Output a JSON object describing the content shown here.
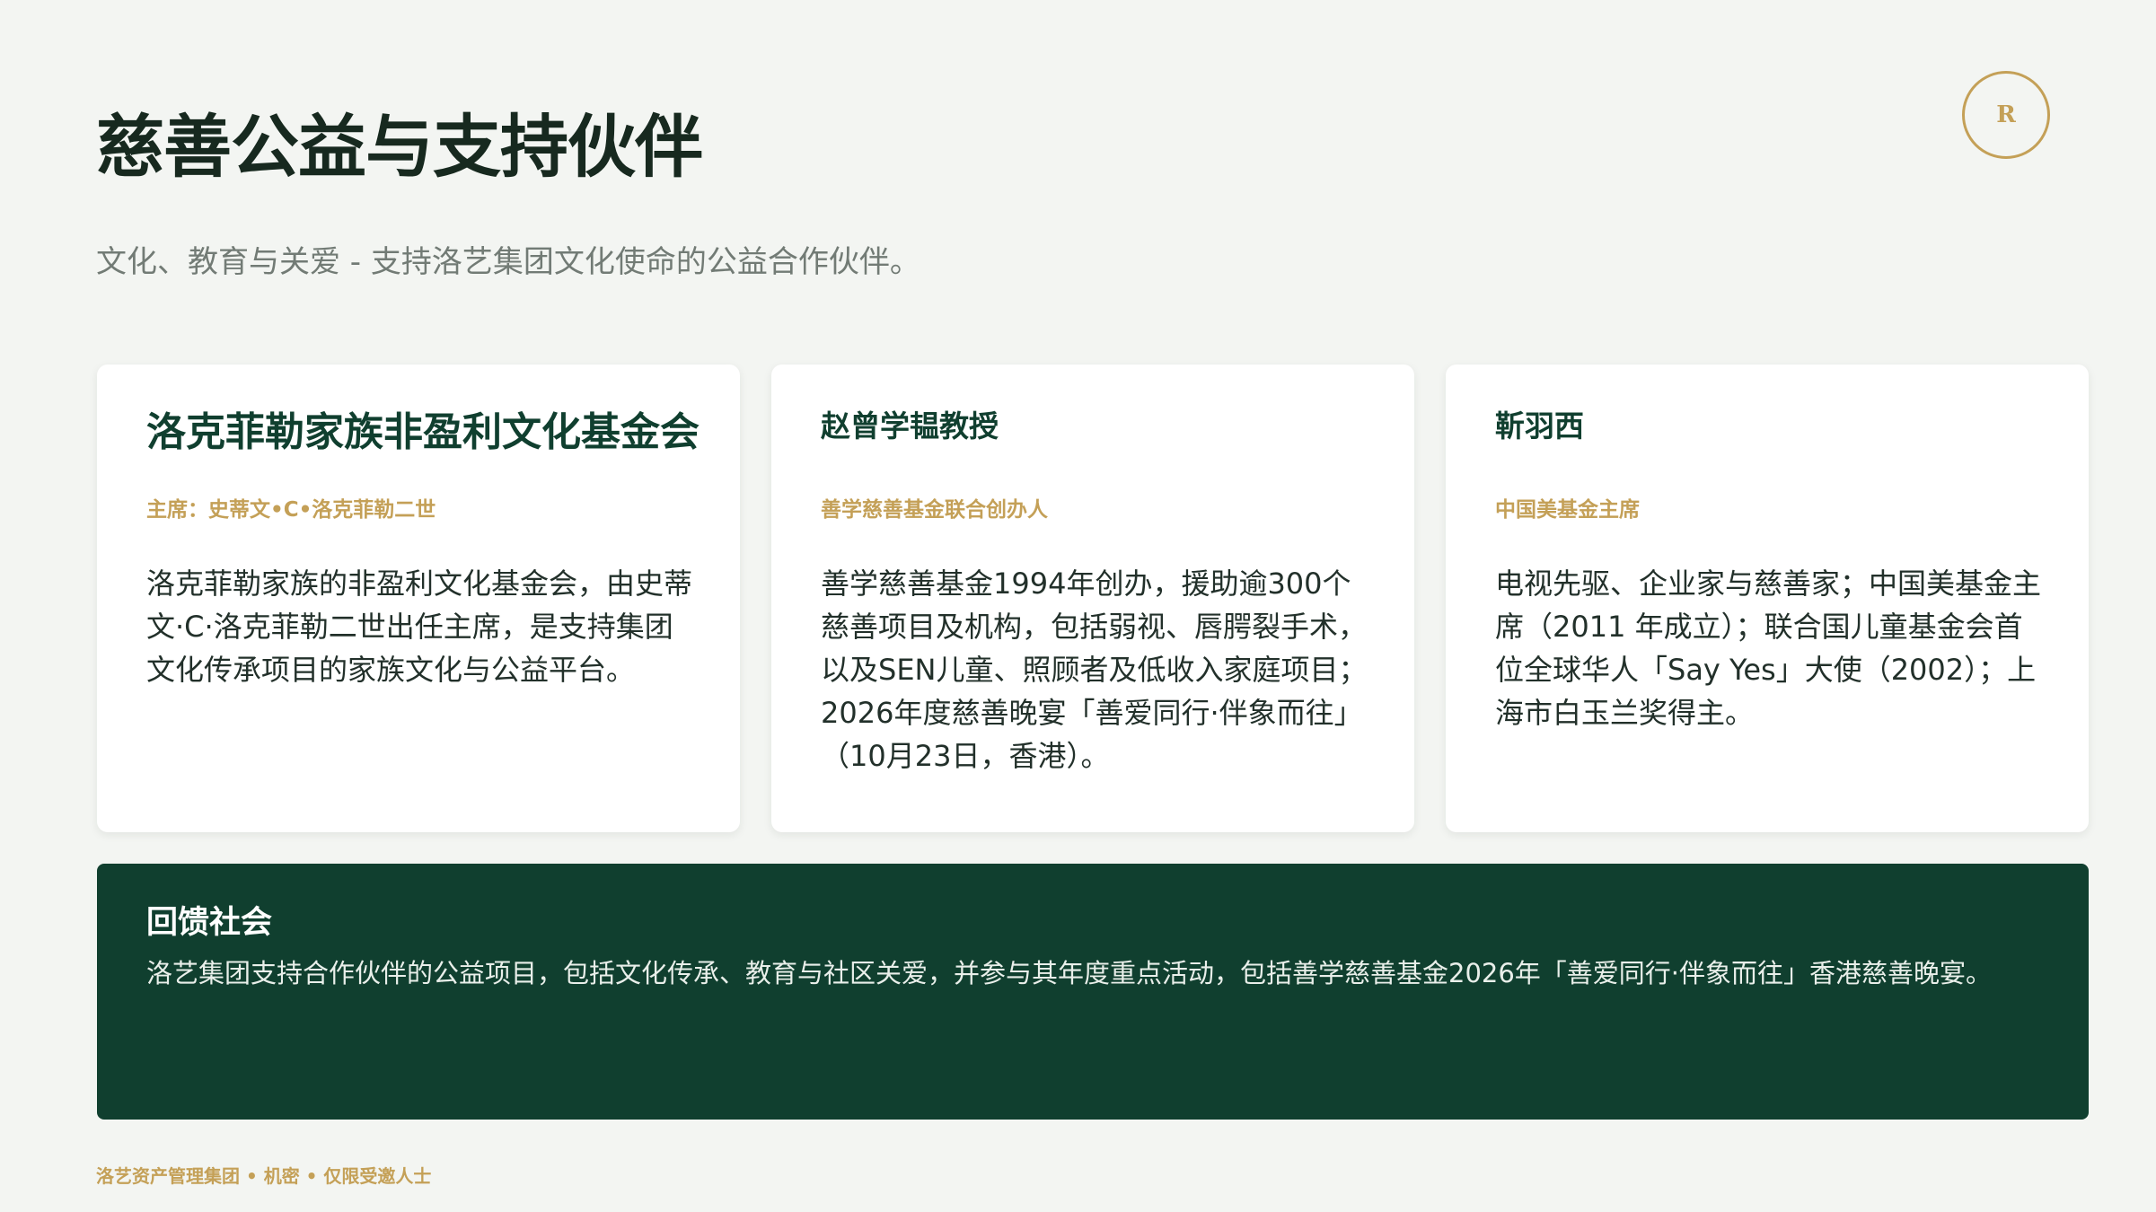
{
  "header": {
    "title": "慈善公益与支持伙伴",
    "subtitle": "文化、教育与关爱 - 支持洛艺集团文化使命的公益合作伙伴。",
    "logo_letter": "R"
  },
  "cards": [
    {
      "name": "洛克菲勒家族非盈利文化基金会",
      "role": "主席：史蒂文•C•洛克菲勒二世",
      "description": "洛克菲勒家族的非盈利文化基金会，由史蒂文·C·洛克菲勒二世出任主席，是支持集团文化传承项目的家族文化与公益平台。"
    },
    {
      "name": "赵曾学韫教授",
      "role": "善学慈善基金联合创办人",
      "description": "善学慈善基金1994年创办，援助逾300个慈善项目及机构，包括弱视、唇腭裂手术，以及SEN儿童、照顾者及低收入家庭项目；2026年度慈善晚宴「善爱同行·伴象而往」（10月23日，香港）。"
    },
    {
      "name": "靳羽西",
      "role": "中国美基金主席",
      "description": "电视先驱、企业家与慈善家；中国美基金主席（2011 年成立）；联合国儿童基金会首位全球华人「Say Yes」大使（2002）；上海市白玉兰奖得主。"
    }
  ],
  "banner": {
    "title": "回馈社会",
    "text": "洛艺集团支持合作伙伴的公益项目，包括文化传承、教育与社区关爱，并参与其年度重点活动，包括善学慈善基金2026年「善爱同行·伴象而往」香港慈善晚宴。"
  },
  "footer": {
    "text": "洛艺资产管理集团 • 机密 • 仅限受邀人士"
  },
  "colors": {
    "background": "#f3f5f2",
    "primary_green": "#103f2f",
    "gold_accent": "#c4a057",
    "subtitle_gray": "#727b75"
  }
}
